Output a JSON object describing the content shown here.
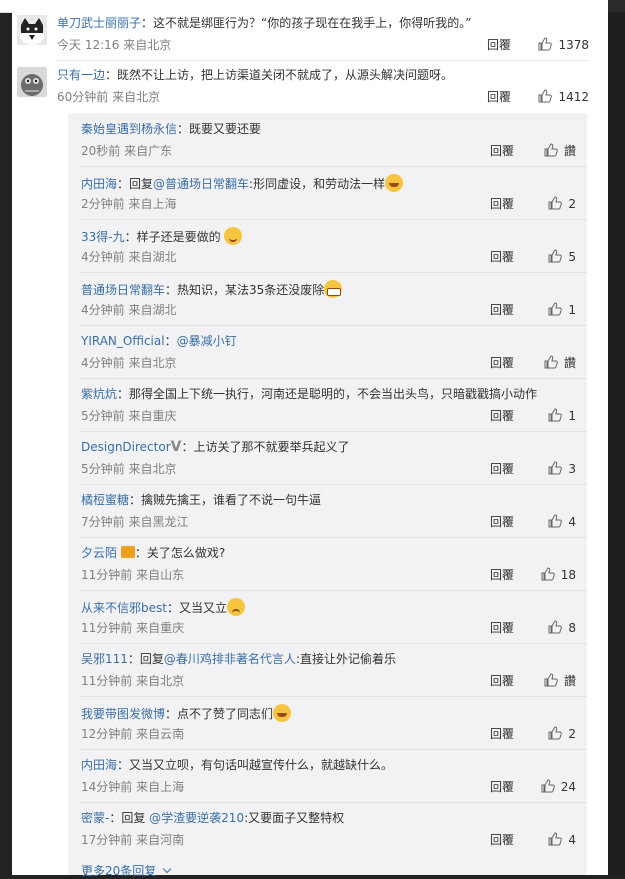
{
  "comments": [
    {
      "user": "单刀武士丽丽子",
      "text": "：这不就是绑匪行为？“你的孩子现在在我手上，你得听我的。”",
      "meta": "今天 12:16 来自北京",
      "reply": "回覆",
      "likes": "1378"
    },
    {
      "user": "只有一边",
      "text": "：既然不让上访，把上访渠道关闭不就成了，从源头解决问题呀。",
      "meta": "60分钟前 来自北京",
      "reply": "回覆",
      "likes": "1412"
    }
  ],
  "replies": [
    {
      "user": "秦始皇遇到杨永信",
      "text": "：既要又要还要",
      "meta": "20秒前 来自广东",
      "reply": "回覆",
      "likes": "讚"
    },
    {
      "user": "内田海",
      "pre": "：回复",
      "mention": "@普通场日常翻车",
      "text": ":形同虚设，和劳动法一样",
      "emoji": "laugh",
      "meta": "2分钟前 来自上海",
      "reply": "回覆",
      "likes": "2"
    },
    {
      "user": "33得-九",
      "text": "：样子还是要做的 ",
      "emoji": "smile",
      "meta": "4分钟前 来自湖北",
      "reply": "回覆",
      "likes": "5"
    },
    {
      "user": "普通场日常翻车",
      "text": "：热知识，某法35条还没废除",
      "emoji": "grin",
      "meta": "4分钟前 来自湖北",
      "reply": "回覆",
      "likes": "1"
    },
    {
      "user": "YIRAN_Official",
      "text": "：",
      "mention": "@暴减小钉",
      "meta": "4分钟前 来自北京",
      "reply": "回覆",
      "likes": "讚"
    },
    {
      "user": "紫炕炕",
      "text": "：那得全国上下统一执行，河南还是聪明的，不会当出头鸟，只暗戳戳搞小动作",
      "meta": "5分钟前 来自重庆",
      "reply": "回覆",
      "likes": "1"
    },
    {
      "user": "DesignDirector",
      "badge": "V",
      "text": "：上访关了那不就要举兵起义了",
      "meta": "5分钟前 来自北京",
      "reply": "回覆",
      "likes": "3"
    },
    {
      "user": "橘梪蜜糖",
      "text": "：擒贼先擒王，谁看了不说一句牛逼",
      "meta": "7分钟前 来自黑龙江",
      "reply": "回覆",
      "likes": "4"
    },
    {
      "user": "夕云陌",
      "crown": true,
      "text": "：关了怎么做戏?",
      "meta": "11分钟前 来自山东",
      "reply": "回覆",
      "likes": "18"
    },
    {
      "user": "从来不信邪best",
      "text": "：又当又立",
      "emoji": "sad",
      "meta": "11分钟前 来自重庆",
      "reply": "回覆",
      "likes": "8"
    },
    {
      "user": "吴邪111",
      "pre": "：回复",
      "mention": "@春川鸡排非著名代言人",
      "text": ":直接让外记偷着乐",
      "meta": "11分钟前 来自北京",
      "reply": "回覆",
      "likes": "讚"
    },
    {
      "user": "我要带图发微博",
      "text": "：点不了赞了同志们",
      "emoji": "laugh",
      "meta": "12分钟前 来自云南",
      "reply": "回覆",
      "likes": "2"
    },
    {
      "user": "内田海",
      "text": "：又当又立呗，有句话叫越宣传什么，就越缺什么。",
      "meta": "14分钟前 来自上海",
      "reply": "回覆",
      "likes": "24"
    },
    {
      "user": "密蒙-",
      "pre": "：回复 ",
      "mention": "@学渣要逆袭210",
      "text": ":又要面子又整特权",
      "meta": "17分钟前 来自河南",
      "reply": "回覆",
      "likes": "4"
    }
  ],
  "more": "更多20条回复"
}
